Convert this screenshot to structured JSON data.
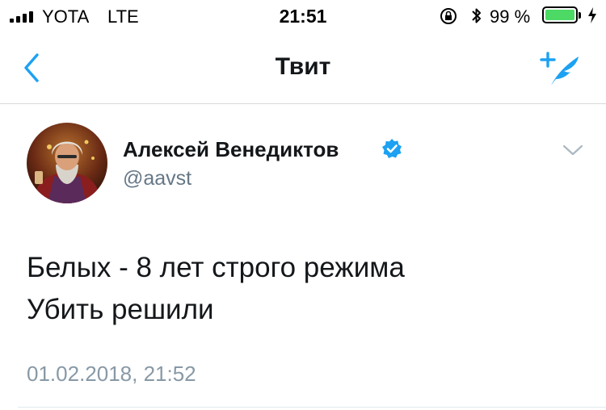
{
  "status_bar": {
    "carrier": "YOTA",
    "network": "LTE",
    "time": "21:51",
    "battery_percent": "99 %",
    "battery_level": 0.99,
    "battery_color": "#4cd964",
    "icons": [
      "signal-icon",
      "orientation-lock-icon",
      "bluetooth-icon",
      "battery-icon",
      "charging-icon"
    ]
  },
  "nav": {
    "title": "Твит",
    "back_icon": "chevron-left-icon",
    "compose_icon": "compose-tweet-icon",
    "accent_color": "#1da1f2"
  },
  "tweet": {
    "author_name": "Алексей Венедиктов",
    "handle": "@aavst",
    "verified": true,
    "lines": [
      "Белых - 8 лет строго режима",
      "Убить решили"
    ],
    "timestamp": "01.02.2018, 21:52"
  }
}
